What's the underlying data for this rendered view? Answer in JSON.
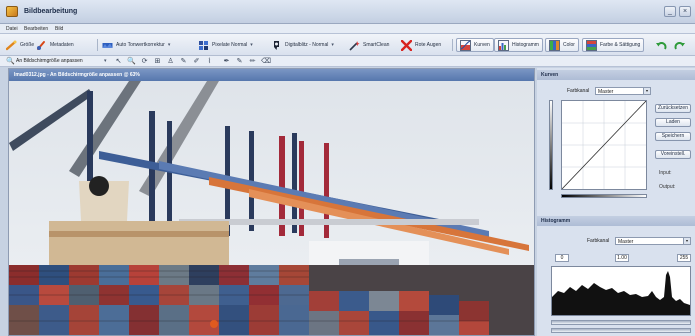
{
  "window": {
    "title": "Bildbearbeitung",
    "minimize": "_",
    "close": "×"
  },
  "menu": [
    "Datei",
    "Bearbeiten",
    "Bild"
  ],
  "toolbar": {
    "buttons": [
      {
        "label": "Größe",
        "icon": "resize-icon"
      },
      {
        "label": "Metadaten",
        "icon": "metadata-icon"
      },
      {
        "label": "Auto Tonwertkorrektur",
        "icon": "auto-levels-icon"
      },
      {
        "label": "Pixelate Normal",
        "icon": "pixelate-icon"
      },
      {
        "label": "Digitalblitz - Normal",
        "icon": "flash-icon"
      },
      {
        "label": "SmartClean",
        "icon": "wand-icon"
      },
      {
        "label": "Rote Augen",
        "icon": "red-eye-icon"
      },
      {
        "label": "Kurven",
        "icon": "curves-icon"
      },
      {
        "label": "Histogramm",
        "icon": "histogram-icon"
      },
      {
        "label": "Color",
        "icon": "color-icon"
      },
      {
        "label": "Farbe & Sättigung",
        "icon": "saturation-icon"
      }
    ],
    "undo_icon": "undo-icon",
    "redo_icon": "redo-icon"
  },
  "toolbar2": {
    "fit_label": "An Bildschirmgröße anpassen",
    "tools": [
      "cursor-icon",
      "zoom-icon",
      "rotate-icon",
      "crop-icon",
      "stamp-icon",
      "pin-icon",
      "brush-icon",
      "lasso-icon",
      "pipette-icon",
      "pencil-icon",
      "pen-icon",
      "eraser-icon"
    ],
    "tool_glyphs": [
      "↖",
      "🔍",
      "⟳",
      "⊞",
      "♙",
      "✎",
      "✐",
      "⌇",
      "✒",
      "✎",
      "✏",
      "⌫"
    ]
  },
  "image": {
    "header": "Imad0312.jpg - An Bildschirmgröße anpassen @ 63%"
  },
  "curves": {
    "title": "Kurven",
    "channel_label": "Farbkanal",
    "channel_value": "Master",
    "buttons": [
      "Zurücksetzen",
      "Laden",
      "Speichern",
      "Voreinstell."
    ],
    "input_label": "Input:",
    "output_label": "Output:"
  },
  "histogram": {
    "title": "Histogramm",
    "channel_label": "Farbkanal",
    "channel_value": "Master",
    "low": "0",
    "gamma": "1.00",
    "high": "255"
  }
}
